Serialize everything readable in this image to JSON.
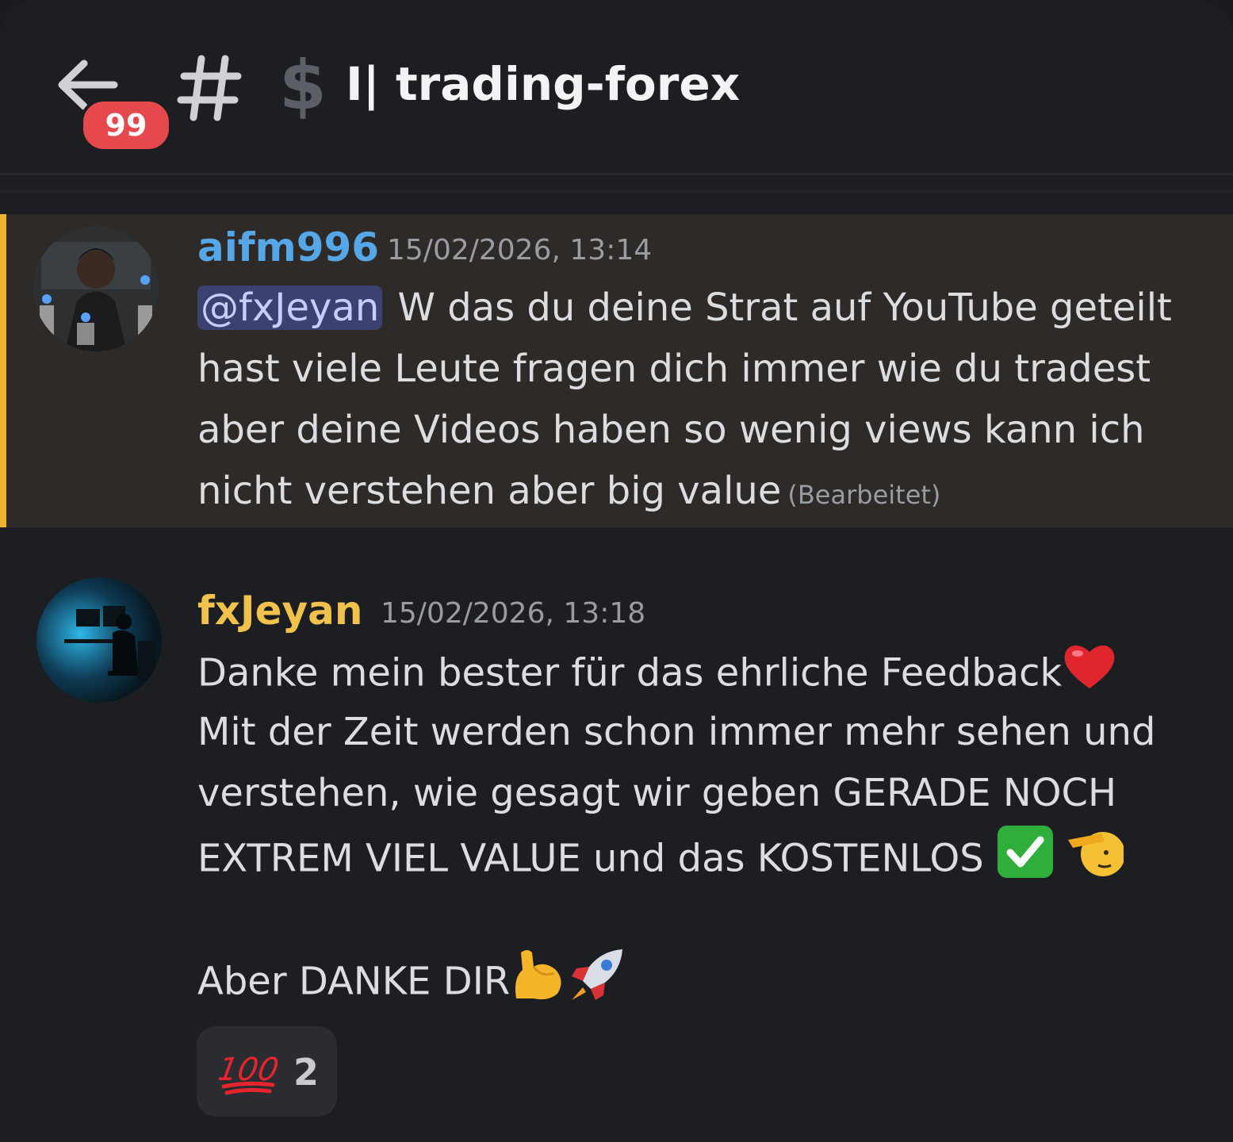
{
  "header": {
    "back_label": "Back",
    "unread_badge": "99",
    "hash_icon": "#",
    "dollar_icon": "$",
    "channel_title": "I| trading-forex"
  },
  "messages": [
    {
      "author": "aifm996",
      "author_color": "#55a7e8",
      "timestamp": "15/02/2026, 13:14",
      "avatar_icon": "dark-character-avatar",
      "highlighted": true,
      "mention": "@fxJeyan",
      "lines": [
        "W das du deine Strat auf YouTube geteilt",
        "hast viele Leute fragen dich immer wie du tradest",
        "aber deine Videos haben so wenig views kann ich",
        "nicht verstehen aber big value"
      ],
      "edited_label": "(Bearbeitet)"
    },
    {
      "author": "fxJeyan",
      "author_color": "#f0c24b",
      "timestamp": "15/02/2026, 13:18",
      "avatar_icon": "desk-silhouette-avatar",
      "lines": [
        "Danke mein bester für das ehrliche Feedback",
        "Mit der Zeit werden schon immer mehr sehen und",
        "verstehen, wie gesagt wir geben GERADE NOCH",
        "EXTREM VIEL VALUE und das KOSTENLOS",
        "",
        "Aber DANKE DIR"
      ],
      "emojis": [
        "red-heart-icon",
        "check-mark-button-icon",
        "saluting-face-icon",
        "flexed-biceps-icon",
        "rocket-icon"
      ],
      "reaction": {
        "emoji": "hundred-points-icon",
        "count": "2"
      }
    }
  ],
  "colors": {
    "background": "#1d1e22",
    "highlight": "#2d2a27",
    "highlight_bar": "#f0b232",
    "badge": "#e5484d",
    "mention_bg": "#3c4270"
  }
}
